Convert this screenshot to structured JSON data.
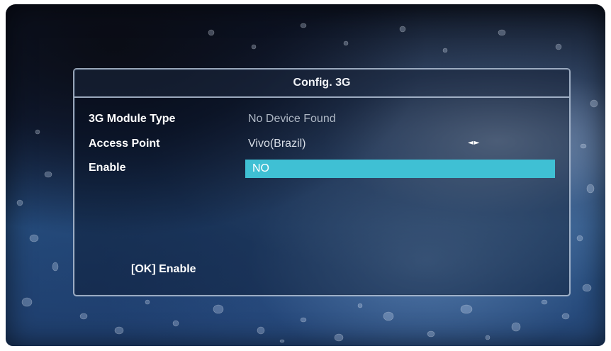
{
  "dialog": {
    "title": "Config. 3G",
    "rows": [
      {
        "label": "3G Module Type",
        "value": "No Device Found"
      },
      {
        "label": "Access Point",
        "value": "Vivo(Brazil)",
        "arrows": "◄►"
      },
      {
        "label": "Enable",
        "value": "NO"
      }
    ],
    "hint": "[OK] Enable"
  },
  "colors": {
    "highlight": "#3fc0d4",
    "border": "#c8d7eb",
    "text": "#ffffff"
  }
}
